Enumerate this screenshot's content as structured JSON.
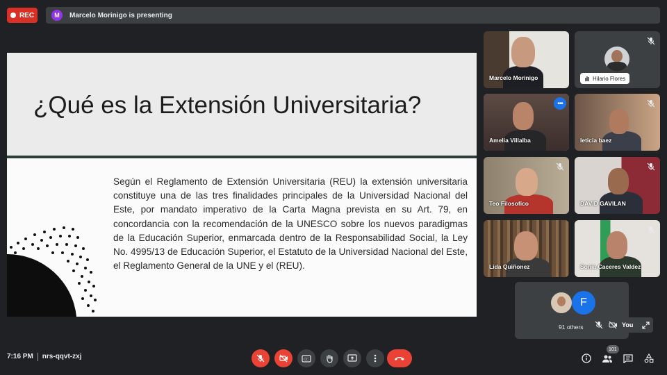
{
  "recording": {
    "label": "REC"
  },
  "presenter_banner": {
    "avatar_letter": "M",
    "text": "Marcelo Morinigo is presenting"
  },
  "slide": {
    "title": "¿Qué es la Extensión Universitaria?",
    "body": "Según el Reglamento de Extensión Universitaria (REU) la extensión universitaria constituye una de las tres finalidades principales de la Universidad Nacional del Este, por mandato imperativo de la Carta Magna prevista en su Art. 79, en concordancia con la recomendación de la UNESCO sobre los nuevos paradigmas de la Educación Superior, enmarcada dentro de la Responsabilidad Social, la Ley No. 4995/13 de Educación Superior, el Estatuto de la Universidad Nacional del Este, el Reglamento General de la UNE y el (REU)."
  },
  "participants": [
    {
      "name": "Marcelo Morinigo"
    },
    {
      "name": "Hilario Flores"
    },
    {
      "name": "Amelia Villalba"
    },
    {
      "name": "leticia baez"
    },
    {
      "name": "Teo Filosofico"
    },
    {
      "name": "DAVID GAVILAN"
    },
    {
      "name": "Lida Quiñonez"
    },
    {
      "name": "Sonia Caceres Valdez"
    }
  ],
  "others_tile": {
    "avatar_letter": "F",
    "count_label": "91 others"
  },
  "self_chip": {
    "label": "You"
  },
  "footer": {
    "time": "7:16 PM",
    "meeting_code": "nrs-qqvt-zxj",
    "participant_count": "101"
  },
  "colors": {
    "accent": "#1a73e8",
    "danger": "#ea4335",
    "surface": "#3c4043",
    "background": "#202124"
  }
}
